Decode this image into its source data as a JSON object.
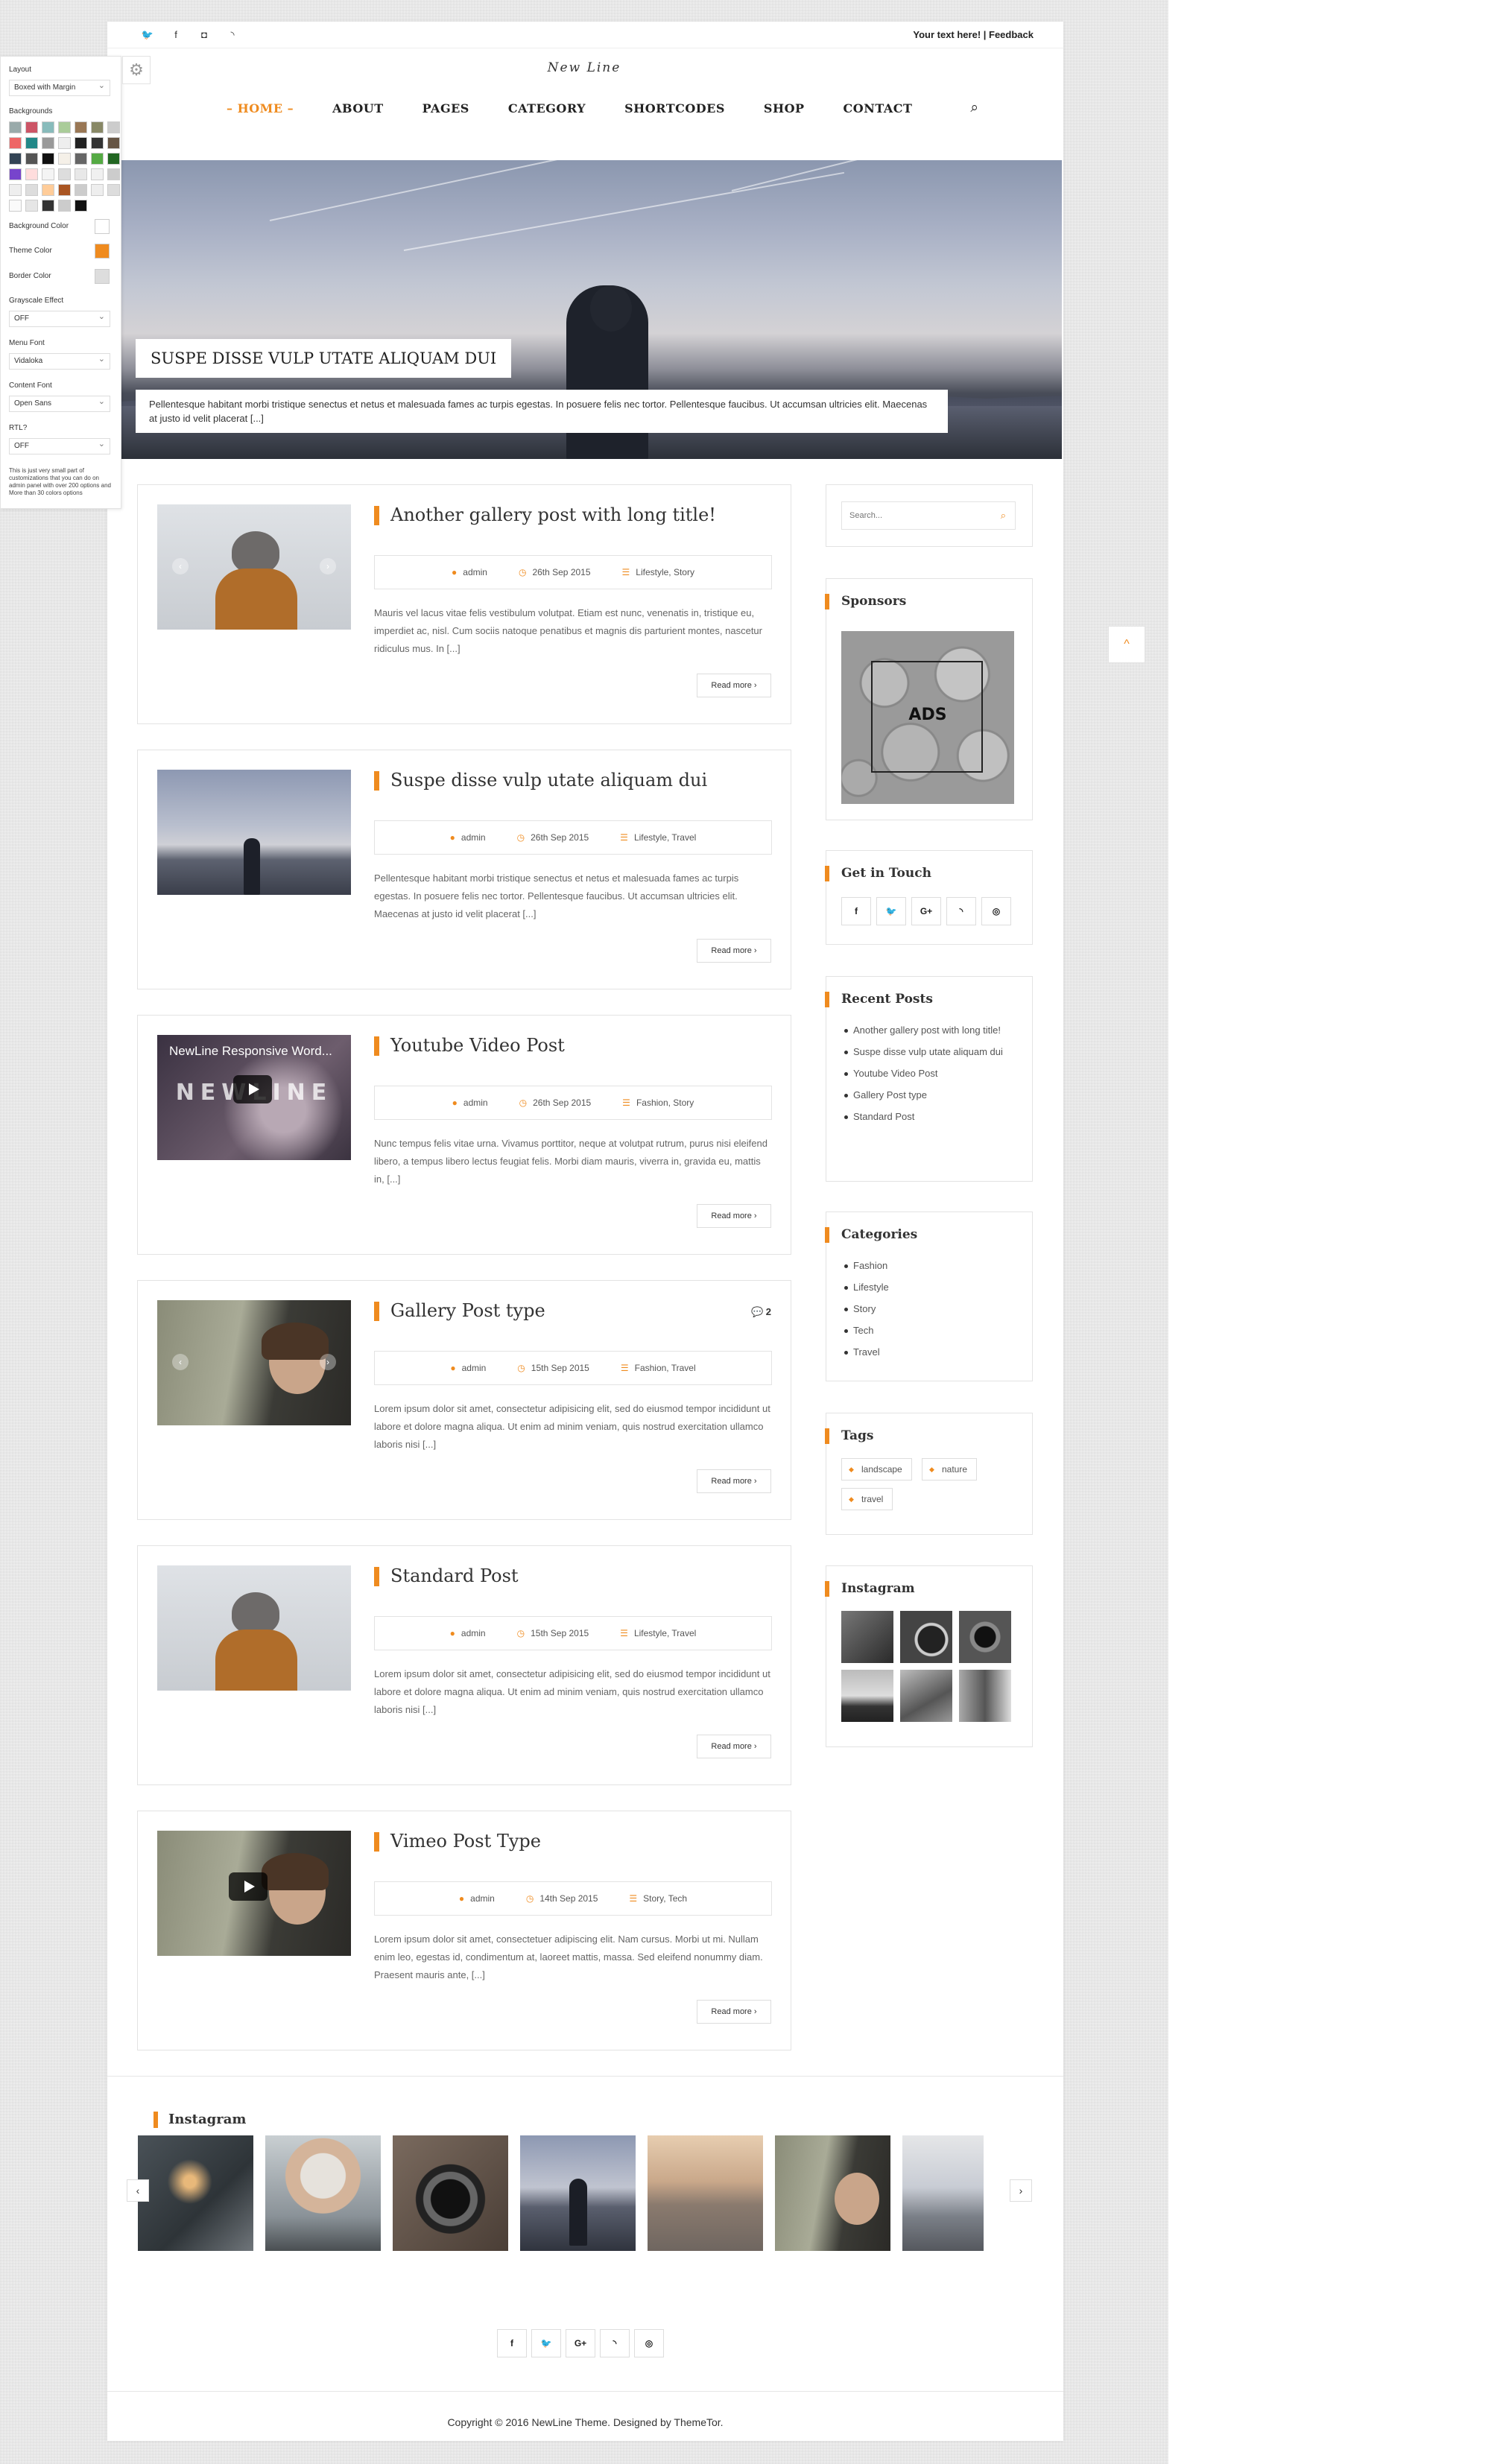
{
  "topbar": {
    "social": [
      "twitter-icon",
      "facebook-icon",
      "flickr-icon",
      "rss-icon"
    ],
    "social_glyphs": [
      "🐦",
      "f",
      "◘",
      "◝"
    ],
    "right_text": "Your text here! | Feedback"
  },
  "logo": "New Line",
  "nav": {
    "items": [
      "HOME",
      "ABOUT",
      "PAGES",
      "CATEGORY",
      "SHORTCODES",
      "SHOP",
      "CONTACT"
    ],
    "active": "HOME",
    "search_glyph": "⌕"
  },
  "hero": {
    "title": "SUSPE DISSE VULP UTATE ALIQUAM DUI",
    "text": "Pellentesque habitant morbi tristique senectus et netus et malesuada fames ac turpis egestas. In posuere felis nec tortor. Pellentesque faucibus. Ut accumsan ultricies elit. Maecenas at justo id velit placerat [...]"
  },
  "posts": [
    {
      "title": "Another gallery post with long title!",
      "author": "admin",
      "date": "26th Sep 2015",
      "categories": "Lifestyle, Story",
      "excerpt": "Mauris vel lacus vitae felis vestibulum volutpat. Etiam est nunc, venenatis in, tristique eu, imperdiet ac, nisl. Cum sociis natoque penatibus et magnis dis parturient montes, nascetur ridiculus mus. In [...]",
      "more": "Read more ›",
      "comments": ""
    },
    {
      "title": "Suspe disse vulp utate aliquam dui",
      "author": "admin",
      "date": "26th Sep 2015",
      "categories": "Lifestyle, Travel",
      "excerpt": "Pellentesque habitant morbi tristique senectus et netus et malesuada fames ac turpis egestas. In posuere felis nec tortor. Pellentesque faucibus. Ut accumsan ultricies elit. Maecenas at justo id velit placerat [...]",
      "more": "Read more ›",
      "comments": ""
    },
    {
      "title": "Youtube Video Post",
      "author": "admin",
      "date": "26th Sep 2015",
      "categories": "Fashion, Story",
      "excerpt": "Nunc tempus felis vitae urna. Vivamus porttitor, neque at volutpat rutrum, purus nisi eleifend libero, a tempus libero lectus feugiat felis. Morbi diam mauris, viverra in, gravida eu, mattis in, [...]",
      "more": "Read more ›",
      "comments": "",
      "video_title": "NewLine Responsive Word...",
      "video_brand": "NEWLINE"
    },
    {
      "title": "Gallery Post type",
      "author": "admin",
      "date": "15th Sep 2015",
      "categories": "Fashion, Travel",
      "excerpt": "Lorem ipsum dolor sit amet, consectetur adipisicing elit, sed do eiusmod tempor incididunt ut labore et dolore magna aliqua. Ut enim ad minim veniam, quis nostrud exercitation ullamco laboris nisi [...]",
      "more": "Read more ›",
      "comments": "💬 2"
    },
    {
      "title": "Standard Post",
      "author": "admin",
      "date": "15th Sep 2015",
      "categories": "Lifestyle, Travel",
      "excerpt": "Lorem ipsum dolor sit amet, consectetur adipisicing elit, sed do eiusmod tempor incididunt ut labore et dolore magna aliqua. Ut enim ad minim veniam, quis nostrud exercitation ullamco laboris nisi [...]",
      "more": "Read more ›",
      "comments": ""
    },
    {
      "title": "Vimeo Post Type",
      "author": "admin",
      "date": "14th Sep 2015",
      "categories": "Story, Tech",
      "excerpt": "Lorem ipsum dolor sit amet, consectetuer adipiscing elit. Nam cursus. Morbi ut mi. Nullam enim leo, egestas id, condimentum at, laoreet mattis, massa. Sed eleifend nonummy diam. Praesent mauris ante, [...]",
      "more": "Read more ›",
      "comments": ""
    }
  ],
  "sidebar": {
    "search_placeholder": "Search...",
    "sponsors_title": "Sponsors",
    "ads_label": "ADS",
    "touch_title": "Get in Touch",
    "touch_glyphs": [
      "f",
      "🐦",
      "G+",
      "◝",
      "◎"
    ],
    "recent_title": "Recent Posts",
    "recent": [
      "Another gallery post with long title!",
      "Suspe disse vulp utate aliquam dui",
      "Youtube Video Post",
      "Gallery Post type",
      "Standard Post"
    ],
    "categories_title": "Categories",
    "categories": [
      "Fashion",
      "Lifestyle",
      "Story",
      "Tech",
      "Travel"
    ],
    "tags_title": "Tags",
    "tags": [
      "landscape",
      "nature",
      "travel"
    ],
    "instagram_title": "Instagram"
  },
  "footer": {
    "instagram_title": "Instagram",
    "social_glyphs": [
      "f",
      "🐦",
      "G+",
      "◝",
      "◎"
    ],
    "copyright": "Copyright © 2016 NewLine Theme. Designed by ThemeTor.",
    "prev": "‹",
    "next": "›"
  },
  "panel": {
    "layout_label": "Layout",
    "layout_value": "Boxed with Margin",
    "backgrounds_label": "Backgrounds",
    "bgcolor_label": "Background Color",
    "theme_label": "Theme Color",
    "border_label": "Border Color",
    "grayscale_label": "Grayscale Effect",
    "grayscale_value": "OFF",
    "menufont_label": "Menu Font",
    "menufont_value": "Vidaloka",
    "contentfont_label": "Content Font",
    "contentfont_value": "Open Sans",
    "rtl_label": "RTL?",
    "rtl_value": "OFF",
    "note": "This is just very small part of customizations that you can do on admin panel with over 200 options and More than 30 colors options",
    "gear_glyph": "⚙"
  },
  "totop_glyph": "^",
  "colors": {
    "accent": "#ef8b1f"
  }
}
